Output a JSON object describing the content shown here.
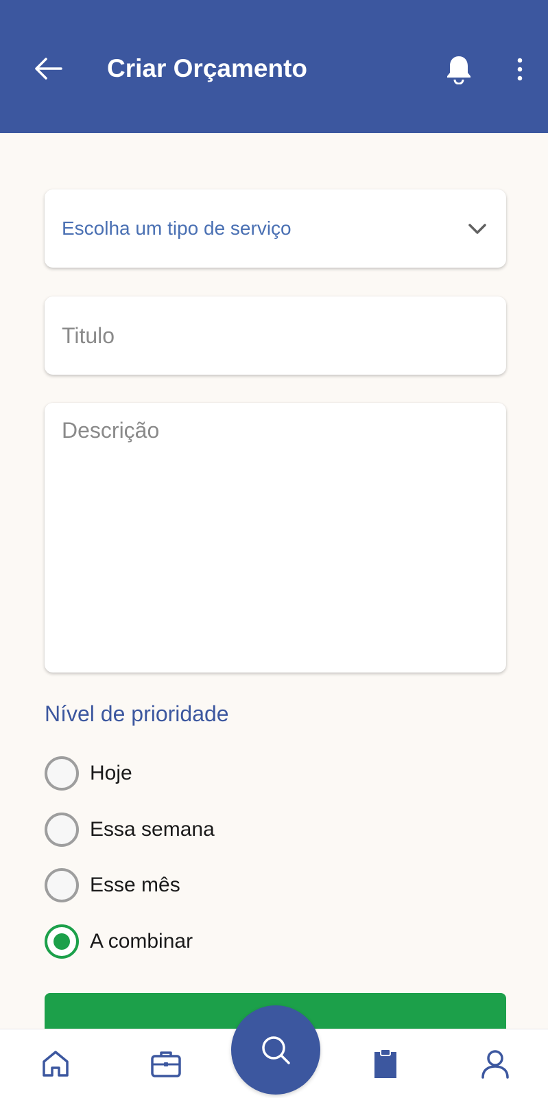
{
  "app_bar": {
    "title": "Criar Orçamento",
    "back_icon": "arrow-left-icon",
    "notification_icon": "bell-icon",
    "menu_icon": "more-vertical-icon",
    "background": "#3c579f"
  },
  "form": {
    "service_type": {
      "placeholder": "Escolha um tipo de serviço",
      "icon": "chevron-down-icon"
    },
    "title_field": {
      "placeholder": "Titulo",
      "value": ""
    },
    "description_field": {
      "placeholder": "Descrição",
      "value": ""
    },
    "priority": {
      "label": "Nível de prioridade",
      "options": [
        "Hoje",
        "Essa semana",
        "Esse mês",
        "A combinar"
      ],
      "selected": "A combinar"
    },
    "submit_color": "#1ca04a"
  },
  "bottom_nav": {
    "items": [
      "home-icon",
      "briefcase-icon",
      "search-icon",
      "clipboard-icon",
      "user-icon"
    ],
    "accent": "#3c579f"
  }
}
